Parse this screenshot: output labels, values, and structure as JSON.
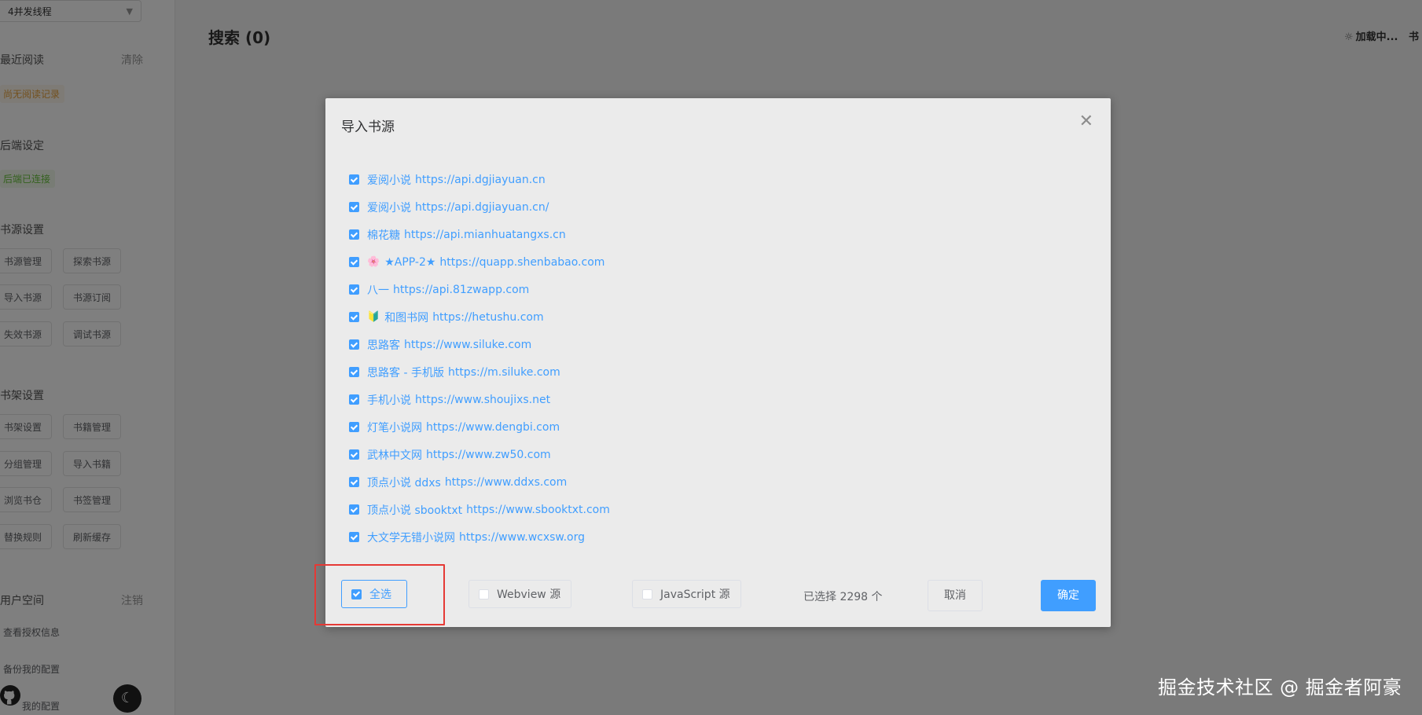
{
  "sidebar": {
    "thread_select": "4并发线程",
    "recent": {
      "title": "最近阅读",
      "action": "清除",
      "empty_tag": "尚无阅读记录"
    },
    "backend": {
      "title": "后端设定",
      "status_tag": "后端已连接"
    },
    "source_settings": {
      "title": "书源设置",
      "buttons": [
        "书源管理",
        "探索书源",
        "导入书源",
        "书源订阅",
        "失效书源",
        "调试书源"
      ]
    },
    "shelf_settings": {
      "title": "书架设置",
      "buttons": [
        "书架设置",
        "书籍管理",
        "分组管理",
        "导入书籍",
        "浏览书仓",
        "书签管理",
        "替换规则",
        "刷新缓存"
      ]
    },
    "user_space": {
      "title": "用户空间",
      "action": "注销",
      "items": [
        "查看授权信息",
        "备份我的配置",
        "我的配置"
      ]
    }
  },
  "main": {
    "title": "搜索 (0)",
    "loading": "加载中...",
    "loading_extra": "书"
  },
  "dialog": {
    "title": "导入书源",
    "sources": [
      {
        "emoji": "",
        "name": "爱阅小说",
        "url": "https://api.dgjiayuan.cn",
        "checked": true
      },
      {
        "emoji": "",
        "name": "爱阅小说",
        "url": "https://api.dgjiayuan.cn/",
        "checked": true
      },
      {
        "emoji": "",
        "name": "棉花糖",
        "url": "https://api.mianhuatangxs.cn",
        "checked": true
      },
      {
        "emoji": "🌸",
        "name": "★APP-2★",
        "url": "https://quapp.shenbabao.com",
        "checked": true
      },
      {
        "emoji": "",
        "name": "八一",
        "url": "https://api.81zwapp.com",
        "checked": true
      },
      {
        "emoji": "🔰",
        "name": "和图书网",
        "url": "https://hetushu.com",
        "checked": true
      },
      {
        "emoji": "",
        "name": "思路客",
        "url": "https://www.siluke.com",
        "checked": true
      },
      {
        "emoji": "",
        "name": "思路客 - 手机版",
        "url": "https://m.siluke.com",
        "checked": true
      },
      {
        "emoji": "",
        "name": "手机小说",
        "url": "https://www.shoujixs.net",
        "checked": true
      },
      {
        "emoji": "",
        "name": "灯笔小说网",
        "url": "https://www.dengbi.com",
        "checked": true
      },
      {
        "emoji": "",
        "name": "武林中文网",
        "url": "https://www.zw50.com",
        "checked": true
      },
      {
        "emoji": "",
        "name": "顶点小说 ddxs",
        "url": "https://www.ddxs.com",
        "checked": true
      },
      {
        "emoji": "",
        "name": "顶点小说 sbooktxt",
        "url": "https://www.sbooktxt.com",
        "checked": true
      },
      {
        "emoji": "",
        "name": "大文学无错小说网",
        "url": "https://www.wcxsw.org",
        "checked": true
      }
    ],
    "footer": {
      "select_all": "全选",
      "webview": "Webview 源",
      "javascript": "JavaScript 源",
      "count_text": "已选择 2298 个",
      "cancel": "取消",
      "confirm": "确定"
    }
  },
  "watermark": "掘金技术社区 @ 掘金者阿豪",
  "colors": {
    "accent": "#409eff",
    "highlight_box": "#e53935"
  }
}
